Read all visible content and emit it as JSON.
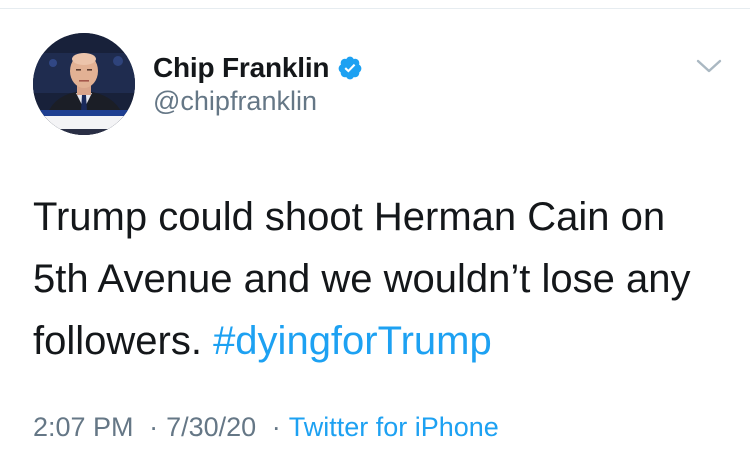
{
  "tweet": {
    "author": {
      "display_name": "Chip Franklin",
      "handle": "@chipfranklin",
      "verified": true,
      "avatar": {
        "ticker_lines": [
          "CHIP FRANKLIN DEMOCRATIC ANALYST",
          "NN'S DON LEMON ON ANTIF",
          "ORGANIZATION IS PER",
          "FOXNEWS"
        ]
      }
    },
    "text_prefix": "Trump could shoot Herman Cain on 5th Avenue and we wouldn’t lose any followers. ",
    "hashtag": "#dyingforTrump",
    "time": "2:07 PM",
    "separator": "·",
    "date": "7/30/20",
    "source": "Twitter for iPhone"
  },
  "icons": {
    "verified": "verified-badge-icon",
    "more": "chevron-down-icon"
  },
  "colors": {
    "link": "#1da1f2",
    "secondary_text": "#657786",
    "primary_text": "#14171a",
    "verified": "#1da1f2"
  }
}
